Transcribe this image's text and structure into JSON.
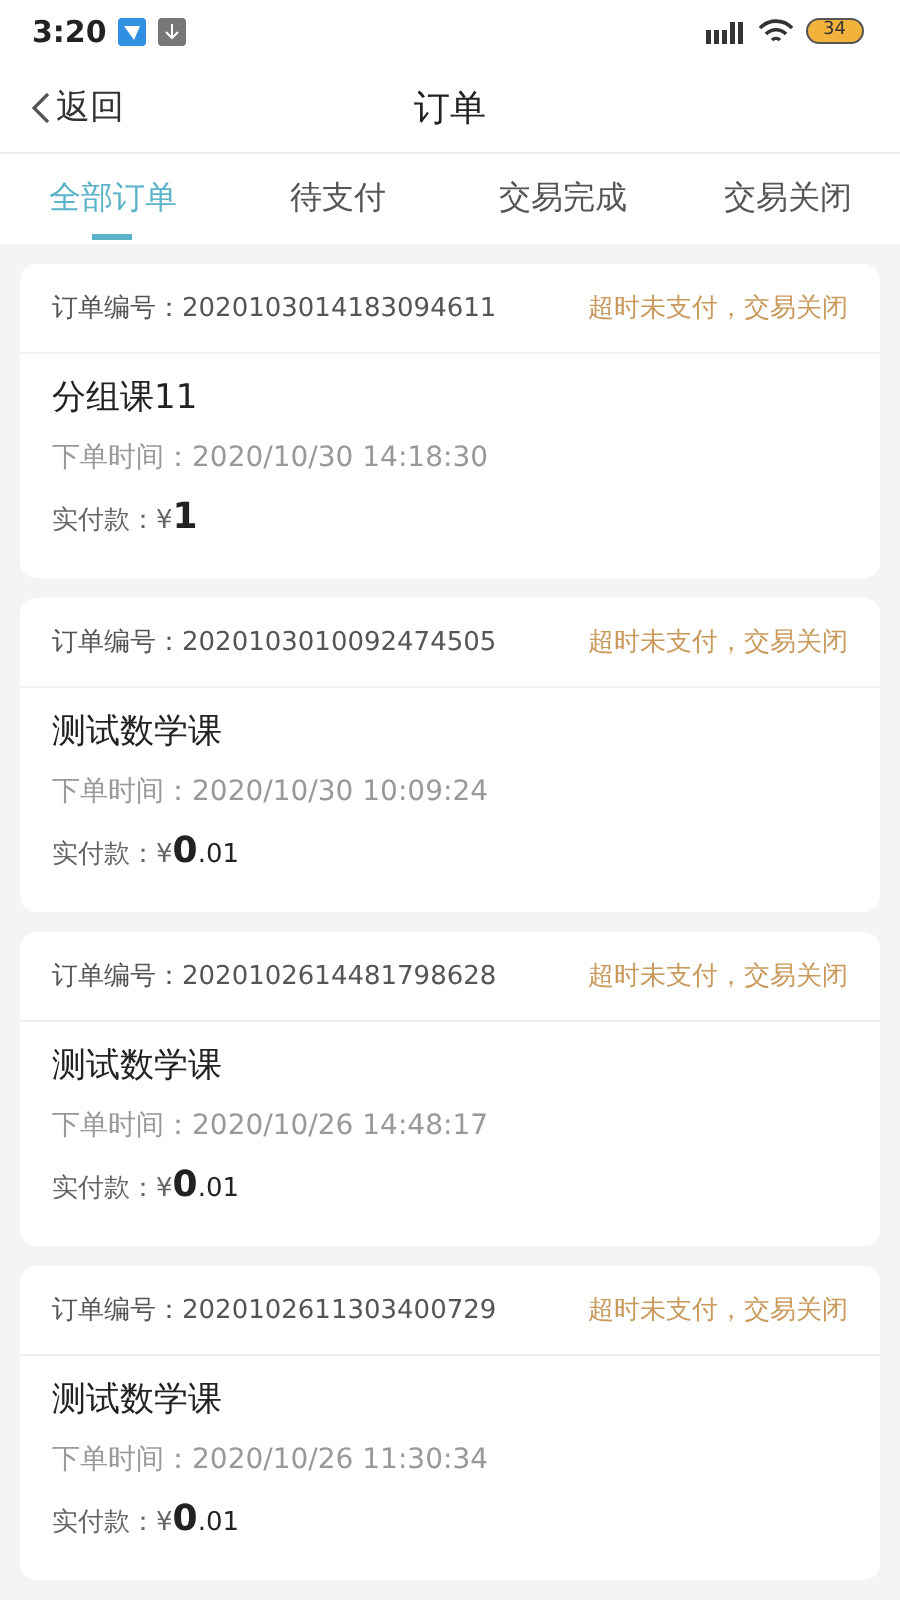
{
  "status_bar": {
    "time": "3:20",
    "battery": "34"
  },
  "header": {
    "back": "返回",
    "title": "订单"
  },
  "tabs": [
    {
      "label": "全部订单",
      "selected": true
    },
    {
      "label": "待支付",
      "selected": false
    },
    {
      "label": "交易完成",
      "selected": false
    },
    {
      "label": "交易关闭",
      "selected": false
    }
  ],
  "orders": [
    {
      "number_label": "订单编号：",
      "number": "2020103014183094611",
      "status": "超时未支付，交易关闭",
      "name": "分组课11",
      "time_label": "下单时间：",
      "time": "2020/10/30 14:18:30",
      "paid_label": "实付款：",
      "currency": "¥",
      "amount": "1"
    },
    {
      "number_label": "订单编号：",
      "number": "2020103010092474505",
      "status": "超时未支付，交易关闭",
      "name": "测试数学课",
      "time_label": "下单时间：",
      "time": "2020/10/30 10:09:24",
      "paid_label": "实付款：",
      "currency": "¥",
      "amount": "0.01"
    },
    {
      "number_label": "订单编号：",
      "number": "2020102614481798628",
      "status": "超时未支付，交易关闭",
      "name": "测试数学课",
      "time_label": "下单时间：",
      "time": "2020/10/26 14:48:17",
      "paid_label": "实付款：",
      "currency": "¥",
      "amount": "0.01"
    },
    {
      "number_label": "订单编号：",
      "number": "2020102611303400729",
      "status": "超时未支付，交易关闭",
      "name": "测试数学课",
      "time_label": "下单时间：",
      "time": "2020/10/26 11:30:34",
      "paid_label": "实付款：",
      "currency": "¥",
      "amount": "0.01"
    }
  ]
}
